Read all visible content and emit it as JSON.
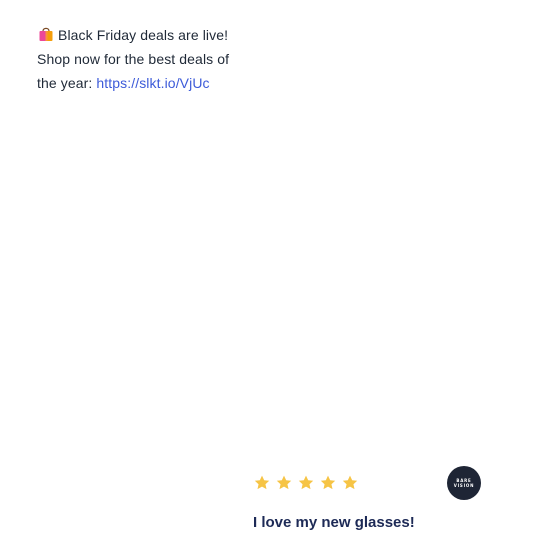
{
  "promo": {
    "line1": "Black Friday deals are live!",
    "line2": "Shop now for the best deals of",
    "line3_prefix": "the year:",
    "link_text": "https://slkt.io/VjUc",
    "icon": "shopping-bag-icon"
  },
  "review": {
    "rating": 5,
    "rating_max": 5,
    "star_color": "#f6c445",
    "title": "I love my new glasses!",
    "brand_logo": {
      "line1": "BARE",
      "line2": "VISION"
    }
  },
  "colors": {
    "link": "#3d5bd9",
    "review_title": "#1d2a56",
    "avatar_bg": "#1e2535"
  }
}
